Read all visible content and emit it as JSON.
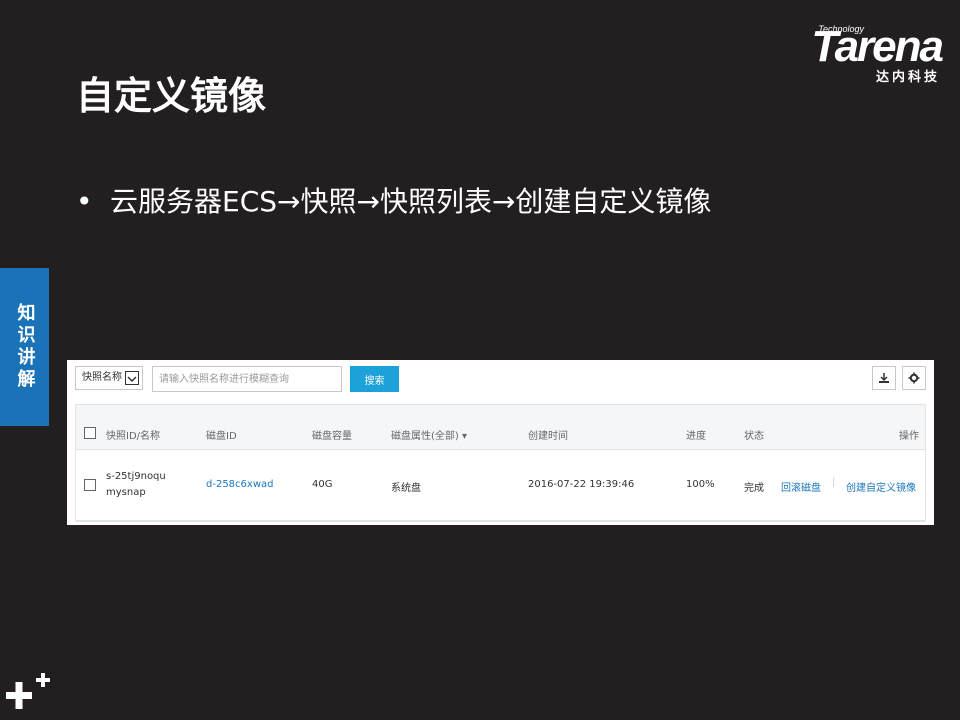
{
  "brand": {
    "tagline": "Technology",
    "name": "Tarena",
    "cn_name": "达内科技"
  },
  "slide": {
    "title": "自定义镜像",
    "bullet": "云服务器ECS→快照→快照列表→创建自定义镜像",
    "side_tab": "知识讲解"
  },
  "screenshot": {
    "toolbar": {
      "filter_select_value": "快照名称",
      "search_placeholder": "请输入快照名称进行模糊查询",
      "search_button": "搜索"
    },
    "table": {
      "headers": {
        "id_name": "快照ID/名称",
        "disk_id": "磁盘ID",
        "disk_size": "磁盘容量",
        "disk_attr": "磁盘属性(全部)",
        "created": "创建时间",
        "progress": "进度",
        "status": "状态",
        "actions": "操作"
      },
      "rows": [
        {
          "id": "s-25tj9noqu",
          "name": "mysnap",
          "disk_id": "d-258c6xwad",
          "disk_size": "40G",
          "disk_attr": "系统盘",
          "created": "2016-07-22 19:39:46",
          "progress": "100%",
          "status": "完成",
          "action_rollback": "回滚磁盘",
          "action_separator": "|",
          "action_create_image": "创建自定义镜像"
        }
      ]
    }
  },
  "colors": {
    "background": "#231f20",
    "side_tab": "#1b73b7",
    "search_button": "#1da1d9",
    "link": "#1a77bf"
  }
}
